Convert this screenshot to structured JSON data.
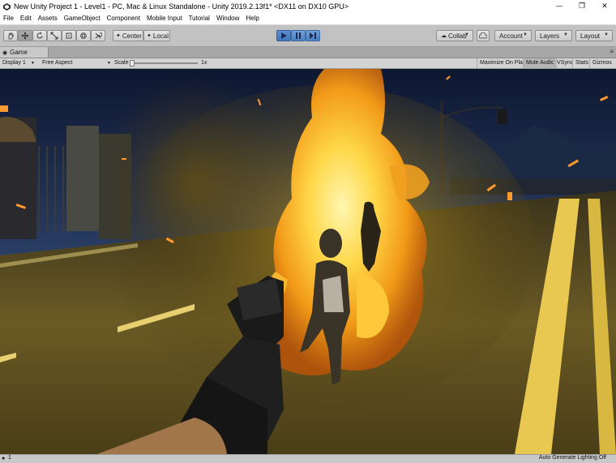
{
  "window": {
    "title": "New Unity Project 1 - Level1 - PC, Mac & Linux Standalone - Unity 2019.2.13f1* <DX11 on DX10 GPU>",
    "minimize": "—",
    "maximize": "❐",
    "close": "✕"
  },
  "menu": [
    "File",
    "Edit",
    "Assets",
    "GameObject",
    "Component",
    "Mobile Input",
    "Tutorial",
    "Window",
    "Help"
  ],
  "toolbar": {
    "pivot_label": "Center",
    "space_label": "Local",
    "collab_label": "Collab",
    "account_label": "Account",
    "layers_label": "Layers",
    "layout_label": "Layout"
  },
  "game_tab": {
    "label": "Game"
  },
  "game_bar": {
    "display": "Display 1",
    "aspect": "Free Aspect",
    "scale_label": "Scale",
    "scale_value": "1x",
    "maximize_on_play": "Maximize On Play",
    "mute_audio": "Mute Audio",
    "vsync": "VSync",
    "stats": "Stats",
    "gizmos": "Gizmos"
  },
  "status": {
    "info": "1",
    "lighting": "Auto Generate Lighting Off"
  },
  "colors": {
    "play_accent": "#4a7fc0",
    "fire_core": "#ffd84a",
    "fire_outer": "#e07a10",
    "night_sky": "#1c2a4a",
    "road": "#3a3420",
    "road_line": "#e8c850"
  }
}
